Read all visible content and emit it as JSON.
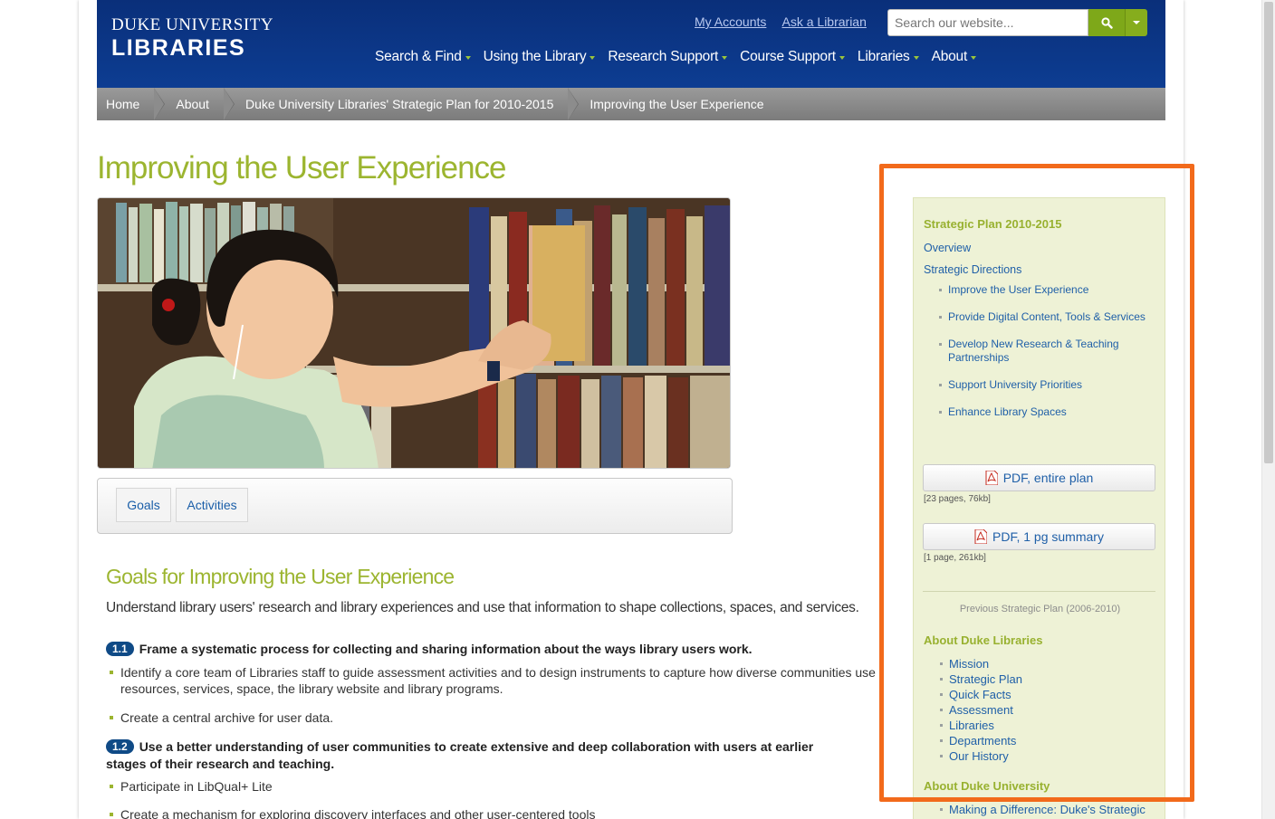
{
  "header": {
    "logo_line1": "DUKE UNIVERSITY",
    "logo_line2": "LIBRARIES",
    "util_links": [
      "My Accounts",
      "Ask a Librarian"
    ],
    "search_placeholder": "Search our website...",
    "nav": [
      "Search & Find",
      "Using the Library",
      "Research Support",
      "Course Support",
      "Libraries",
      "About"
    ]
  },
  "breadcrumb": [
    "Home",
    "About",
    "Duke University Libraries' Strategic Plan for 2010-2015",
    "Improving the User Experience"
  ],
  "page": {
    "title": "Improving the User Experience",
    "tabs": [
      "Goals",
      "Activities"
    ],
    "goals_title": "Goals for Improving the User Experience",
    "goals_intro": "Understand library users' research and library experiences and use that information to shape collections, spaces, and services.",
    "goals": [
      {
        "badge": "1.1",
        "text": "Frame a systematic process for collecting and sharing information about the ways library users work.",
        "bullets": [
          "Identify a core team of Libraries staff to guide assessment activities and to design instruments to capture how diverse communities use",
          "resources, services, space, the library website and library programs.",
          "Create a central archive for user data."
        ]
      },
      {
        "badge": "1.2",
        "text_line1": "Use a better understanding of user communities to create extensive and deep collaboration with users at earlier",
        "text_line2": "stages of their research and teaching.",
        "bullets": [
          "Participate in LibQual+ Lite",
          "Create a mechanism for exploring discovery interfaces and other user-centered tools"
        ]
      }
    ]
  },
  "sidebar": {
    "heading": "Strategic Plan 2010-2015",
    "links": [
      "Overview",
      "Strategic Directions"
    ],
    "directions": [
      "Improve the User Experience",
      "Provide Digital Content, Tools & Services",
      "Develop New Research & Teaching",
      "Partnerships",
      "Support University Priorities",
      "Enhance Library Spaces"
    ],
    "pdf1_label": "PDF, entire plan",
    "pdf1_meta": "[23 pages, 76kb]",
    "pdf2_label": "PDF, 1 pg summary",
    "pdf2_meta": "[1 page, 261kb]",
    "previous_plan": "Previous Strategic Plan (2006-2010)",
    "about_libraries_heading": "About Duke Libraries",
    "about_libraries_links": [
      "Mission",
      "Strategic Plan",
      "Quick Facts",
      "Assessment",
      "Libraries",
      "Departments",
      "Our History"
    ],
    "about_university_heading": "About Duke University",
    "about_university_links": [
      "Making a Difference: Duke's Strategic"
    ]
  },
  "colors": {
    "header_blue": "#0b3a8c",
    "accent_green": "#9cb530",
    "link_blue": "#2060a8",
    "highlight_orange": "#f26a1b"
  }
}
